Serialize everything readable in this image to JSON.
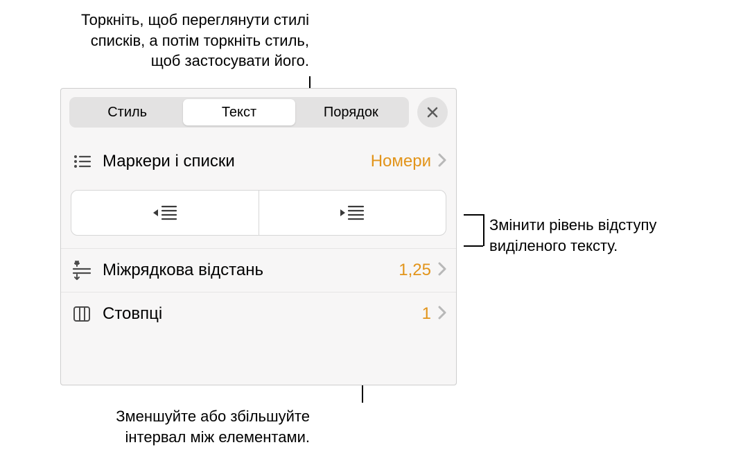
{
  "callouts": {
    "top": "Торкніть, щоб переглянути стилі списків, а потім торкніть стиль, щоб застосувати його.",
    "right": "Змінити рівень відступу виділеного тексту.",
    "bottom": "Зменшуйте або збільшуйте інтервал між елементами."
  },
  "tabs": {
    "style": "Стиль",
    "text": "Текст",
    "order": "Порядок"
  },
  "rows": {
    "bullets": {
      "label": "Маркери і списки",
      "value": "Номери"
    },
    "lineSpacing": {
      "label": "Міжрядкова відстань",
      "value": "1,25"
    },
    "columns": {
      "label": "Стовпці",
      "value": "1"
    }
  },
  "colors": {
    "accent": "#e2941a"
  }
}
